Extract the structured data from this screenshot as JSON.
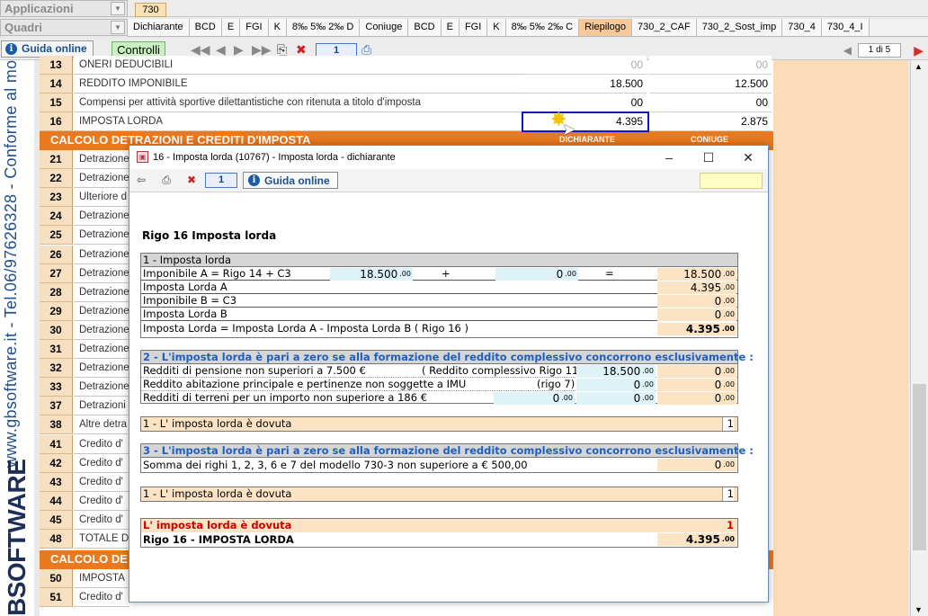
{
  "top": {
    "combo1": "Applicazioni",
    "combo2": "Quadri",
    "year_tab": "730",
    "tabs": [
      "Dichiarante",
      "BCD",
      "E",
      "FGI",
      "K",
      "8‰ 5‰ 2‰ D",
      "Coniuge",
      "BCD",
      "E",
      "FGI",
      "K",
      "8‰ 5‰ 2‰ C",
      "Riepilogo",
      "730_2_CAF",
      "730_2_Sost_imp",
      "730_4",
      "730_4_I"
    ],
    "active_tab": "Riepilogo"
  },
  "toolbar": {
    "guida": "Guida online",
    "controlli": "Controlli",
    "page": "1",
    "pager": "1 di 5"
  },
  "side": {
    "vertical_text": "www.gbsoftware.it - Tel.06/97626328 - Conforme al mo",
    "logo": "BSOFTWARE"
  },
  "sheet": {
    "rows": [
      {
        "n": "13",
        "label": "ONERI DEDUCIBILI",
        "v1": "00",
        "v2": "00"
      },
      {
        "n": "14",
        "label": "REDDITO IMPONIBILE",
        "v1": "18.500",
        "v2": "12.500"
      },
      {
        "n": "15",
        "label": "Compensi per attività sportive dilettantistiche con ritenuta a titolo d'imposta",
        "v1": "00",
        "v2": "00"
      },
      {
        "n": "16",
        "label": "IMPOSTA LORDA",
        "v1": "4.395",
        "v2": "2.875"
      }
    ],
    "section1": "CALCOLO DETRAZIONI E CREDITI D'IMPOSTA",
    "section1_col1": "DICHIARANTE",
    "section1_col2": "CONIUGE",
    "lower_rows": [
      {
        "n": "21",
        "label": "Detrazione"
      },
      {
        "n": "22",
        "label": "Detrazione"
      },
      {
        "n": "23",
        "label": "Ulteriore d"
      },
      {
        "n": "24",
        "label": "Detrazione"
      },
      {
        "n": "25",
        "label": "Detrazione"
      },
      {
        "n": "26",
        "label": "Detrazione"
      },
      {
        "n": "27",
        "label": "Detrazione"
      },
      {
        "n": "28",
        "label": "Detrazione"
      },
      {
        "n": "29",
        "label": "Detrazione"
      },
      {
        "n": "30",
        "label": "Detrazione"
      },
      {
        "n": "31",
        "label": "Detrazione"
      },
      {
        "n": "32",
        "label": "Detrazione"
      },
      {
        "n": "33",
        "label": "Detrazione"
      },
      {
        "n": "37",
        "label": "Detrazioni"
      },
      {
        "n": "38",
        "label": "Altre detra"
      },
      {
        "n": "41",
        "label": "Credito d'"
      },
      {
        "n": "42",
        "label": "Credito d'"
      },
      {
        "n": "43",
        "label": "Credito d'"
      },
      {
        "n": "44",
        "label": "Credito d'"
      },
      {
        "n": "45",
        "label": "Credito d'"
      },
      {
        "n": "48",
        "label": "TOTALE D"
      }
    ],
    "section2": "CALCOLO DE",
    "bottom_rows": [
      {
        "n": "50",
        "label": "IMPOSTA"
      },
      {
        "n": "51",
        "label": "Credito d'"
      }
    ]
  },
  "dialog": {
    "title": "16 - Imposta lorda (10767) - Imposta lorda - dichiarante",
    "page": "1",
    "guida": "Guida online",
    "heading": "Rigo 16 Imposta lorda",
    "s1_title": "1 - Imposta lorda",
    "s1": {
      "imponibile_a": "Imponibile A = Rigo 14 + C3",
      "val_a1": "18.500",
      "plus": "+",
      "val_a2": "0",
      "eq": "=",
      "val_a3": "18.500",
      "imposta_a": "Imposta Lorda A",
      "imposta_a_val": "4.395",
      "imponibile_b": "Imponibile B = C3",
      "imponibile_b_val": "0",
      "imposta_b": "Imposta Lorda B",
      "imposta_b_val": "0",
      "totale": "Imposta Lorda = Imposta Lorda A - Imposta Lorda B ( Rigo 16 )",
      "totale_val": "4.395"
    },
    "s2_title": "2 - L'imposta lorda è pari a zero se alla formazione del reddito complessivo concorrono esclusivamente :",
    "s2": {
      "r1": "Redditi di pensione non superiori a 7.500 €",
      "r1_note": "( Reddito complessivo Rigo 11)",
      "r1_v1": "18.500",
      "r1_v2": "0",
      "r2": "Reddito abitazione principale e pertinenze non soggette a IMU",
      "r2_note": "(rigo 7)",
      "r2_v1": "0",
      "r2_v2": "0",
      "r3": "Redditi di terreni per un importo non superiore a  186 €",
      "r3_v1": "0",
      "r3_v2": "0",
      "r3_v3": "0",
      "result": "1 - L' imposta lorda è dovuta",
      "result_code": "1"
    },
    "s3_title": "3 - L'imposta lorda è pari a zero se alla formazione del reddito complessivo concorrono esclusivamente :",
    "s3": {
      "r1": "Somma dei righi 1, 2, 3, 6 e 7 del modello 730-3 non superiore a € 500,00",
      "r1_v": "0",
      "result": "1 - L' imposta lorda è dovuta",
      "result_code": "1"
    },
    "final": {
      "msg": "L' imposta lorda è dovuta",
      "msg_code": "1",
      "rigo": "Rigo 16 -  IMPOSTA LORDA",
      "rigo_val": "4.395"
    },
    "decimals": ".00"
  }
}
